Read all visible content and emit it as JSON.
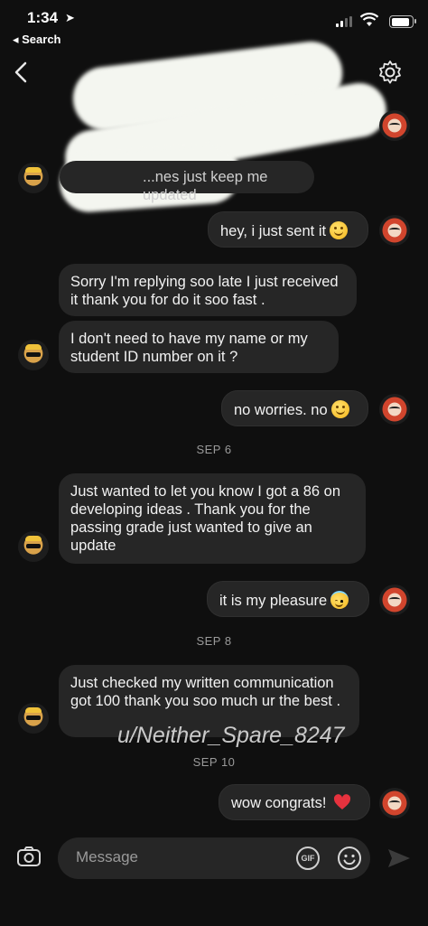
{
  "status_bar": {
    "time": "1:34",
    "back_label": "◂ Search"
  },
  "thread": {
    "messages": [
      {
        "side": "left",
        "text": "...nes just keep me updated"
      },
      {
        "side": "right",
        "text": "hey, i just sent it",
        "emoji": "smile"
      },
      {
        "side": "left",
        "text": "Sorry I'm replying soo late I just received it thank you for do it soo fast ."
      },
      {
        "side": "left",
        "text": "I don't need to have my name or my student ID number on it ?"
      },
      {
        "side": "right",
        "text": "no worries. no",
        "emoji": "smile"
      },
      {
        "side": "date",
        "text": "SEP 6"
      },
      {
        "side": "left",
        "text": "Just wanted to let you know I got a 86 on developing ideas  . Thank you for the passing grade just wanted to give an update"
      },
      {
        "side": "right",
        "text": "it is my pleasure",
        "emoji": "halo"
      },
      {
        "side": "date",
        "text": "SEP 8"
      },
      {
        "side": "left",
        "text": "Just checked my written communication  got 100 thank you soo much ur the best ."
      },
      {
        "side": "date",
        "text": "SEP 10"
      },
      {
        "side": "right",
        "text": "wow congrats!",
        "emoji": "heart"
      }
    ],
    "watermark": "u/Neither_Spare_8247"
  },
  "composer": {
    "placeholder": "Message",
    "gif_label": "GIF"
  }
}
